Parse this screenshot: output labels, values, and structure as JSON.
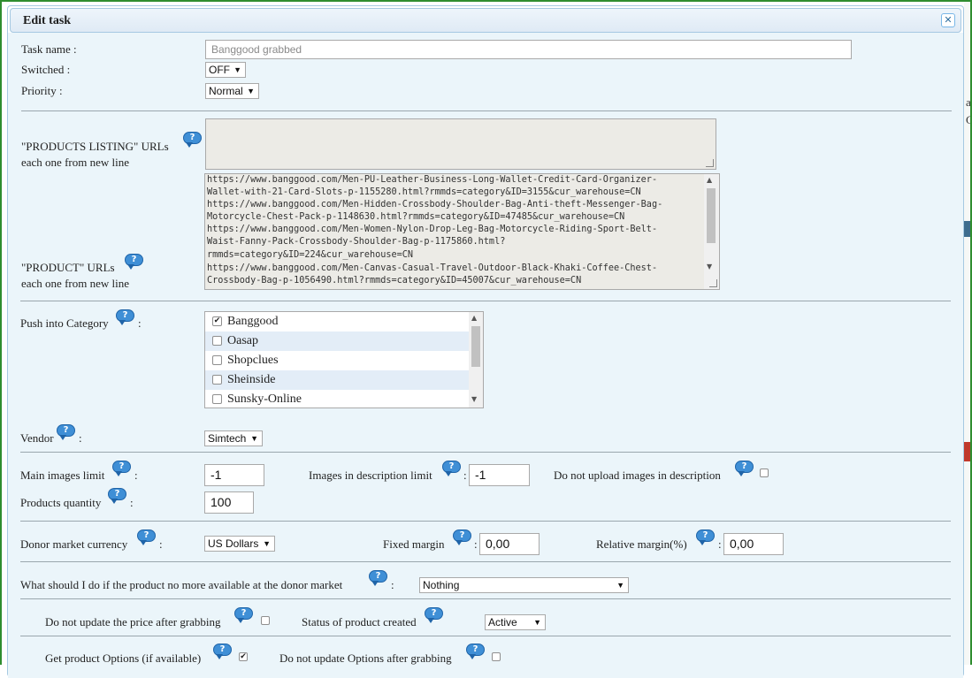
{
  "dialog": {
    "title": "Edit task",
    "close_icon": "close-icon"
  },
  "task_name": {
    "label": "Task name :",
    "placeholder": "Banggood grabbed"
  },
  "switched": {
    "label": "Switched :",
    "value": "OFF"
  },
  "priority": {
    "label": "Priority :",
    "value": "Normal"
  },
  "products_listing": {
    "label": "\"PRODUCTS LISTING\" URLs",
    "sub": "each one from new line"
  },
  "product_urls": {
    "label": "\"PRODUCT\" URLs",
    "sub": "each one from new line",
    "lines": [
      "https://www.banggood.com/Men-PU-Leather-Business-Long-Wallet-Credit-Card-Organizer-",
      "Wallet-with-21-Card-Slots-p-1155280.html?rmmds=category&ID=3155&cur_warehouse=CN",
      "https://www.banggood.com/Men-Hidden-Crossbody-Shoulder-Bag-Anti-theft-Messenger-Bag-",
      "Motorcycle-Chest-Pack-p-1148630.html?rmmds=category&ID=47485&cur_warehouse=CN",
      "https://www.banggood.com/Men-Women-Nylon-Drop-Leg-Bag-Motorcycle-Riding-Sport-Belt-",
      "Waist-Fanny-Pack-Crossbody-Shoulder-Bag-p-1175860.html?",
      "rmmds=category&ID=224&cur_warehouse=CN",
      "https://www.banggood.com/Men-Canvas-Casual-Travel-Outdoor-Black-Khaki-Coffee-Chest-",
      "Crossbody-Bag-p-1056490.html?rmmds=category&ID=45007&cur_warehouse=CN"
    ]
  },
  "push_category": {
    "label": "Push into Category",
    "colon": ":",
    "items": [
      {
        "label": "Banggood",
        "checked": true
      },
      {
        "label": "Oasap",
        "checked": false
      },
      {
        "label": "Shopclues",
        "checked": false
      },
      {
        "label": "Sheinside",
        "checked": false
      },
      {
        "label": "Sunsky-Online",
        "checked": false
      }
    ]
  },
  "vendor": {
    "label": "Vendor",
    "colon": ":",
    "value": "Simtech"
  },
  "main_images_limit": {
    "label": "Main images limit",
    "colon": ":",
    "value": "-1"
  },
  "images_desc_limit": {
    "label": "Images in description limit",
    "colon": ":",
    "value": "-1"
  },
  "no_upload_desc": {
    "label": "Do not upload images in description"
  },
  "products_quantity": {
    "label": "Products quantity",
    "colon": ":",
    "value": "100"
  },
  "donor_currency": {
    "label": "Donor market currency",
    "colon": ":",
    "value": "US Dollars"
  },
  "fixed_margin": {
    "label": "Fixed margin",
    "colon": ":",
    "value": "0,00"
  },
  "relative_margin": {
    "label": "Relative margin(%)",
    "colon": ":",
    "value": "0,00"
  },
  "not_available": {
    "label": "What should I do if the product no more available at the donor market",
    "colon": ":",
    "value": "Nothing"
  },
  "no_update_price": {
    "label": "Do not update the price after grabbing"
  },
  "status_created": {
    "label": "Status of product created",
    "value": "Active"
  },
  "get_options": {
    "label": "Get product Options (if available)"
  },
  "no_update_options": {
    "label": "Do not update Options after grabbing"
  },
  "help_glyph": "?",
  "check_glyph": "✔",
  "right_edge": {
    "line1": "a",
    "line2": "C"
  }
}
